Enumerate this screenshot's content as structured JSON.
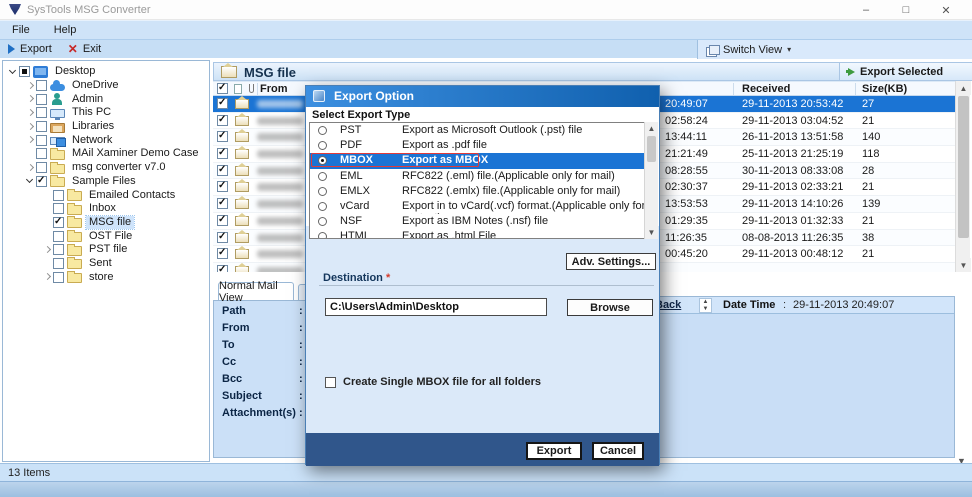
{
  "window": {
    "title": "SysTools MSG Converter"
  },
  "menu": {
    "items": [
      "File",
      "Help"
    ]
  },
  "toolbar": {
    "export_label": "Export",
    "exit_label": "Exit",
    "switch_view_label": "Switch View"
  },
  "main_header": {
    "title": "MSG file",
    "export_selected_label": "Export Selected"
  },
  "tree": {
    "items": [
      {
        "label": "Desktop",
        "level": 0,
        "expander": "down",
        "check": "partial",
        "icon": "desktop",
        "selected": false
      },
      {
        "label": "OneDrive",
        "level": 1,
        "expander": "right",
        "check": "unchecked",
        "icon": "cloud",
        "selected": false
      },
      {
        "label": "Admin",
        "level": 1,
        "expander": "right",
        "check": "unchecked",
        "icon": "user",
        "selected": false
      },
      {
        "label": "This PC",
        "level": 1,
        "expander": "right",
        "check": "unchecked",
        "icon": "pc",
        "selected": false
      },
      {
        "label": "Libraries",
        "level": 1,
        "expander": "right",
        "check": "unchecked",
        "icon": "library",
        "selected": false
      },
      {
        "label": "Network",
        "level": 1,
        "expander": "right",
        "check": "unchecked",
        "icon": "network",
        "selected": false
      },
      {
        "label": "MAil Xaminer Demo Case",
        "level": 1,
        "expander": "none",
        "check": "unchecked",
        "icon": "folder",
        "selected": false
      },
      {
        "label": "msg converter v7.0",
        "level": 1,
        "expander": "right",
        "check": "unchecked",
        "icon": "folder",
        "selected": false
      },
      {
        "label": "Sample Files",
        "level": 1,
        "expander": "down",
        "check": "checked",
        "icon": "folder",
        "selected": false
      },
      {
        "label": "Emailed Contacts",
        "level": 2,
        "expander": "none",
        "check": "unchecked",
        "icon": "folder",
        "selected": false
      },
      {
        "label": "Inbox",
        "level": 2,
        "expander": "none",
        "check": "unchecked",
        "icon": "folder",
        "selected": false
      },
      {
        "label": "MSG file",
        "level": 2,
        "expander": "none",
        "check": "checked",
        "icon": "folder",
        "selected": true
      },
      {
        "label": "OST File",
        "level": 2,
        "expander": "none",
        "check": "unchecked",
        "icon": "folder",
        "selected": false
      },
      {
        "label": "PST file",
        "level": 2,
        "expander": "right",
        "check": "unchecked",
        "icon": "folder",
        "selected": false
      },
      {
        "label": "Sent",
        "level": 2,
        "expander": "none",
        "check": "unchecked",
        "icon": "folder",
        "selected": false
      },
      {
        "label": "store",
        "level": 2,
        "expander": "right",
        "check": "unchecked",
        "icon": "folder",
        "selected": false
      }
    ]
  },
  "table": {
    "columns": {
      "from": "From",
      "received": "Received",
      "size": "Size(KB)"
    },
    "rows": [
      {
        "time": "20:49:07",
        "received": "29-11-2013 20:53:42",
        "size": "27",
        "selected": true
      },
      {
        "time": "02:58:24",
        "received": "29-11-2013 03:04:52",
        "size": "21",
        "selected": false
      },
      {
        "time": "13:44:11",
        "received": "26-11-2013 13:51:58",
        "size": "140",
        "selected": false
      },
      {
        "time": "21:21:49",
        "received": "25-11-2013 21:25:19",
        "size": "118",
        "selected": false
      },
      {
        "time": "08:28:55",
        "received": "30-11-2013 08:33:08",
        "size": "28",
        "selected": false
      },
      {
        "time": "02:30:37",
        "received": "29-11-2013 02:33:21",
        "size": "21",
        "selected": false
      },
      {
        "time": "13:53:53",
        "received": "29-11-2013 14:10:26",
        "size": "139",
        "selected": false
      },
      {
        "time": "01:29:35",
        "received": "29-11-2013 01:32:33",
        "size": "21",
        "selected": false
      },
      {
        "time": "11:26:35",
        "received": "08-08-2013 11:26:35",
        "size": "38",
        "selected": false
      },
      {
        "time": "00:45:20",
        "received": "29-11-2013 00:48:12",
        "size": "21",
        "selected": false
      },
      {
        "time": "",
        "received": "",
        "size": "",
        "selected": false,
        "partial": true
      }
    ]
  },
  "preview": {
    "tab": "Normal Mail View",
    "fields": [
      {
        "label": "Path",
        "sep": ":"
      },
      {
        "label": "From",
        "sep": ":"
      },
      {
        "label": "To",
        "sep": ":"
      },
      {
        "label": "Cc",
        "sep": ":"
      },
      {
        "label": "Bcc",
        "sep": ":"
      },
      {
        "label": "Subject",
        "sep": ":"
      },
      {
        "label": "Attachment(s)",
        "sep": ":"
      }
    ],
    "back_label": "Back",
    "datetime_label": "Date Time",
    "separator": ":",
    "datetime_value": "29-11-2013 20:49:07"
  },
  "dialog": {
    "title": "Export Option",
    "section_label": "Select Export Type",
    "options": [
      {
        "name": "PST",
        "desc": "Export as Microsoft Outlook (.pst) file",
        "selected": false
      },
      {
        "name": "PDF",
        "desc": "Export as .pdf file",
        "selected": false
      },
      {
        "name": "MBOX",
        "desc": "Export as MBOX",
        "selected": true
      },
      {
        "name": "EML",
        "desc": "RFC822 (.eml) file.(Applicable only for mail)",
        "selected": false
      },
      {
        "name": "EMLX",
        "desc": "RFC822 (.emlx) file.(Applicable only for mail)",
        "selected": false
      },
      {
        "name": "vCard",
        "desc": "Export in to vCard(.vcf) format.(Applicable only for contact)",
        "selected": false
      },
      {
        "name": "NSF",
        "desc": "Export as IBM Notes (.nsf) file",
        "selected": false
      },
      {
        "name": "HTML",
        "desc": "Export as .html File",
        "selected": false
      }
    ],
    "adv_settings_label": "Adv. Settings...",
    "destination_label": "Destination",
    "required_marker": "*",
    "destination_value": "C:\\Users\\Admin\\Desktop",
    "browse_label": "Browse",
    "checkbox_label": "Create Single MBOX file for all folders",
    "export_label": "Export",
    "cancel_label": "Cancel"
  },
  "status_bar": {
    "text": "13 Items"
  },
  "colors": {
    "selection_blue": "#1b74d4",
    "dialog_header_blue": "#2f86d8",
    "dialog_footer_blue": "#30568b",
    "highlight_red": "#e03a3a",
    "chrome_blue": "#cfe3f8"
  }
}
